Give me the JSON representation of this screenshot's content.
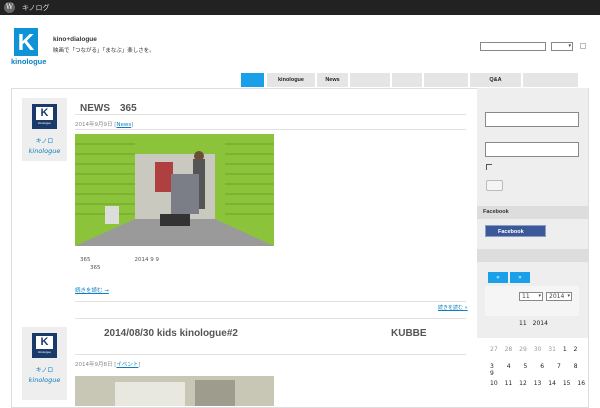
{
  "admin_bar": {
    "site_name": "キノログ"
  },
  "header": {
    "logo_letter": "K",
    "logo_word": "kinologue",
    "site_title": "kino+dialogue",
    "site_description": "映画で「つながる」「まなぶ」楽しさを。"
  },
  "nav": {
    "tabs": [
      "",
      "kinologue",
      "News",
      "",
      "",
      "",
      "Q&A",
      ""
    ]
  },
  "posts": [
    {
      "title": "NEWS　365",
      "author": "キノロ",
      "author_sub": "kinologue",
      "meta_date": "2014年9月9日",
      "meta_category": "News",
      "excerpt_line1": "365　　　　　　　　2014 9 9",
      "excerpt_line2": "365",
      "read_more": "続きを読む →",
      "continue_link": "続きを読む »"
    },
    {
      "title": "2014/08/30 kids kinologue#2",
      "title_right": "KUBBE",
      "author": "キノロ",
      "author_sub": "kinologue",
      "meta_date": "2014年9月8日",
      "meta_category": "イベント"
    }
  ],
  "sidebar": {
    "facebook_heading": "Facebook",
    "facebook_button": "Facebook",
    "calendar": {
      "prev": "«",
      "next": "»",
      "month_value": "11",
      "year_value": "2014",
      "caption": "11　2014",
      "week_row_1": [
        "27",
        "28",
        "29",
        "30",
        "31",
        "1",
        "2"
      ],
      "week_row_2": [
        "3",
        "4",
        "5",
        "6",
        "7",
        "8",
        "9"
      ],
      "week_row_3": [
        "10",
        "11",
        "12",
        "13",
        "14",
        "15",
        "16"
      ]
    }
  },
  "colors": {
    "accent": "#1aa0e8",
    "logo_blue": "#0d93d6",
    "link": "#0d7fc0",
    "admin_bar": "#222222"
  }
}
